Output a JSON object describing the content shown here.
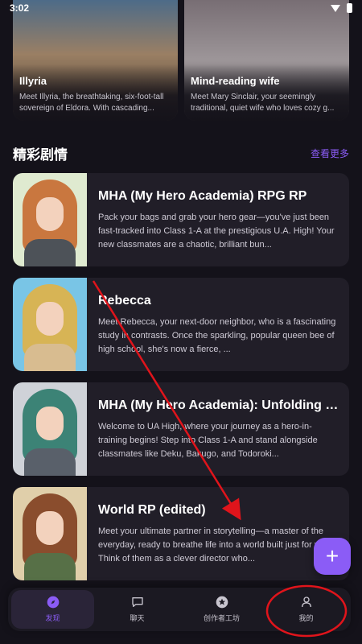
{
  "status_bar": {
    "time": "3:02"
  },
  "featured": [
    {
      "title": "Illyria",
      "description": "Meet Illyria, the breathtaking, six-foot-tall sovereign of Eldora. With cascading..."
    },
    {
      "title": "Mind-reading wife",
      "description": "Meet Mary Sinclair, your seemingly traditional, quiet wife who loves cozy g..."
    }
  ],
  "section": {
    "title": "精彩剧情",
    "see_more": "查看更多"
  },
  "stories": [
    {
      "title": "MHA (My Hero Academia) RPG RP",
      "description": "Pack your bags and grab your hero gear—you've just been fast-tracked into Class 1-A at the prestigious U.A. High! Your new classmates are a chaotic, brilliant bun..."
    },
    {
      "title": "Rebecca",
      "description": "Meet Rebecca, your next-door neighbor, who is a fascinating study in contrasts. Once the sparkling, popular queen bee of high school, she's now a fierce, ..."
    },
    {
      "title": "MHA (My Hero Academia): Unfolding C...",
      "description": "Welcome to UA High, where your journey as a hero-in-training begins! Step into Class 1-A and stand alongside classmates like Deku, Bakugo, and Todoroki..."
    },
    {
      "title": "World RP (edited)",
      "description": "Meet your ultimate partner in storytelling—a master of the everyday, ready to breathe life into a world built just for you. Think of them as a clever director who..."
    }
  ],
  "fab": {
    "symbol": "+"
  },
  "nav": [
    {
      "label": "发现",
      "icon": "compass-icon",
      "active": true
    },
    {
      "label": "聊天",
      "icon": "chat-bubble-icon",
      "active": false
    },
    {
      "label": "创作者工坊",
      "icon": "star-badge-icon",
      "active": false
    },
    {
      "label": "我的",
      "icon": "person-icon",
      "active": false
    }
  ],
  "colors": {
    "accent": "#8b5cf6",
    "background": "#14121a",
    "card": "#211e28",
    "annotation": "#e0141b"
  }
}
